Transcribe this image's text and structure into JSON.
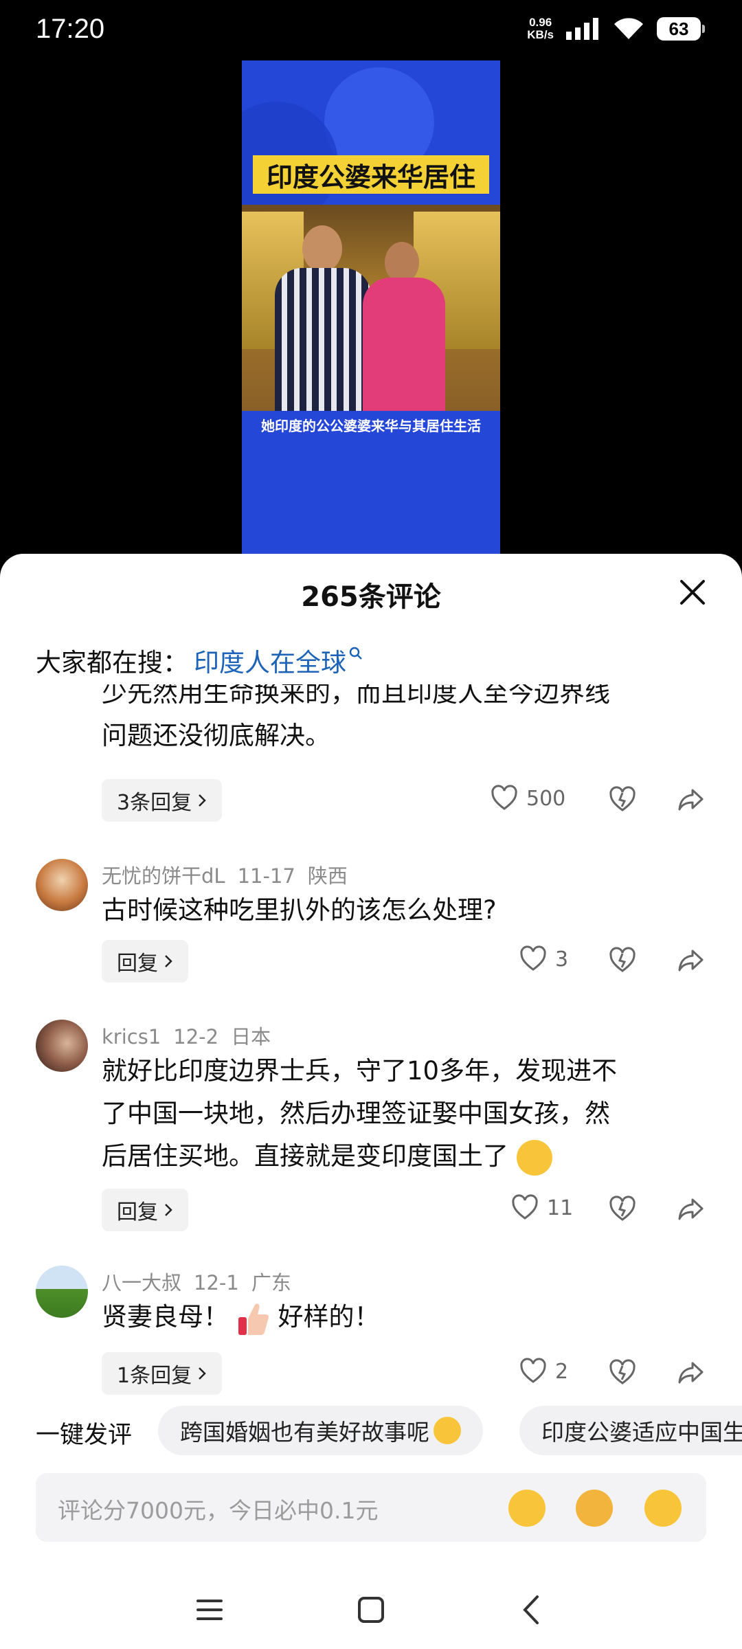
{
  "status_bar": {
    "time": "17:20",
    "net_speed_value": "0.96",
    "net_speed_unit": "KB/s",
    "battery": "63"
  },
  "video": {
    "banner_text": "印度公婆来华居住",
    "caption": "她印度的公公婆婆来华与其居住生活"
  },
  "sheet": {
    "title": "265条评论",
    "hot_search_label": "大家都在搜：",
    "hot_search_link": "印度人在全球"
  },
  "comments": [
    {
      "text_line1": "少先然用生命换来的，而且印度人至今边界线",
      "text_line2": "问题还没彻底解决。",
      "reply_label": "3条回复",
      "likes": "500"
    },
    {
      "username": "无忧的饼干dL",
      "date": "11-17",
      "location": "陕西",
      "text": "古时候这种吃里扒外的该怎么处理?",
      "reply_label": "回复",
      "likes": "3"
    },
    {
      "username": "krics1",
      "date": "12-2",
      "location": "日本",
      "text_line1": "就好比印度边界士兵，守了10多年，发现进不",
      "text_line2": "了中国一块地，然后办理签证娶中国女孩，然",
      "text_line3": "后居住买地。直接就是变印度国土了",
      "reply_label": "回复",
      "likes": "11"
    },
    {
      "username": "八一大叔",
      "date": "12-1",
      "location": "广东",
      "text_a": "贤妻良母！",
      "text_b": "好样的！",
      "reply_label": "1条回复",
      "likes": "2"
    }
  ],
  "quick_comment": {
    "label": "一键发评",
    "chip1": "跨国婚姻也有美好故事呢",
    "chip2": "印度公婆适应中国生活"
  },
  "input": {
    "placeholder": "评论分7000元，今日必中0.1元"
  },
  "colors": {
    "link": "#1d63b8",
    "video_bg": "#2547d8",
    "banner": "#f4d236"
  }
}
